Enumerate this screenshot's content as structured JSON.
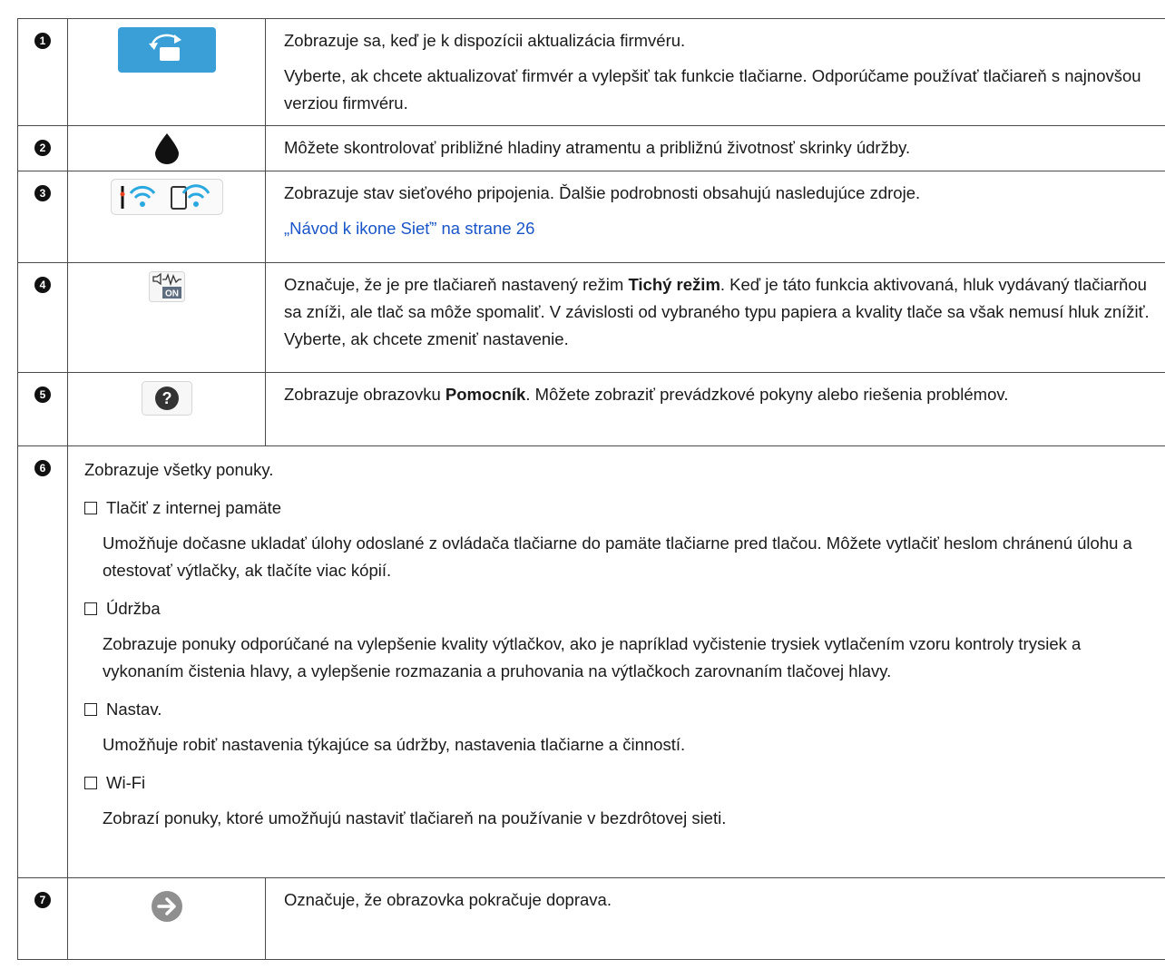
{
  "rows": [
    {
      "num": "1",
      "icon": "firmware-update-icon",
      "text": [
        "Zobrazuje sa, keď je k dispozícii aktualizácia firmvéru.",
        "Vyberte, ak chcete aktualizovať firmvér a vylepšiť tak funkcie tlačiarne. Odporúčame používať tlačiareň s najnovšou verziou firmvéru."
      ]
    },
    {
      "num": "2",
      "icon": "ink-drop-icon",
      "text": [
        "Môžete skontrolovať približné hladiny atramentu a približnú životnosť skrinky údržby."
      ]
    },
    {
      "num": "3",
      "icon": "network-status-icon",
      "text": [
        "Zobrazuje stav sieťového pripojenia. Ďalšie podrobnosti obsahujú nasledujúce zdroje."
      ],
      "link": "„Návod k ikone Sieť” na strane 26"
    },
    {
      "num": "4",
      "icon": "quiet-mode-icon",
      "icon_text": "ON",
      "text_before": "Označuje, že je pre tlačiareň nastavený režim ",
      "text_bold": "Tichý režim",
      "text_after": ". Keď je táto funkcia aktivovaná, hluk vydávaný tlačiarňou sa zníži, ale tlač sa môže spomaliť. V závislosti od vybraného typu papiera a kvality tlače sa však nemusí hluk znížiť. Vyberte, ak chcete zmeniť nastavenie."
    },
    {
      "num": "5",
      "icon": "help-icon",
      "icon_text": "?",
      "text_before": "Zobrazuje obrazovku ",
      "text_bold": "Pomocník",
      "text_after": ". Môžete zobraziť prevádzkové pokyny alebo riešenia problémov."
    },
    {
      "num": "6",
      "lead": "Zobrazuje všetky ponuky.",
      "items": [
        {
          "title": "Tlačiť z internej pamäte",
          "desc": "Umožňuje dočasne ukladať úlohy odoslané z ovládača tlačiarne do pamäte tlačiarne pred tlačou. Môžete vytlačiť heslom chránenú úlohu a otestovať výtlačky, ak tlačíte viac kópií."
        },
        {
          "title": "Údržba",
          "desc": "Zobrazuje ponuky odporúčané na vylepšenie kvality výtlačkov, ako je napríklad vyčistenie trysiek vytlačením vzoru kontroly trysiek a vykonaním čistenia hlavy, a vylepšenie rozmazania a pruhovania na výtlačkoch zarovnaním tlačovej hlavy."
        },
        {
          "title": "Nastav.",
          "desc": "Umožňuje robiť nastavenia týkajúce sa údržby, nastavenia tlačiarne a činností."
        },
        {
          "title": "Wi-Fi",
          "desc": "Zobrazí ponuky, ktoré umožňujú nastaviť tlačiareň na používanie v bezdrôtovej sieti."
        }
      ]
    },
    {
      "num": "7",
      "icon": "arrow-right-icon",
      "text": [
        "Označuje, že obrazovka pokračuje doprava."
      ]
    }
  ],
  "colors": {
    "firmware_icon_bg": "#3a9fd6",
    "link": "#1a55c8",
    "wifi": "#2aa8e0",
    "arrow_icon": "#8f8f8f"
  }
}
